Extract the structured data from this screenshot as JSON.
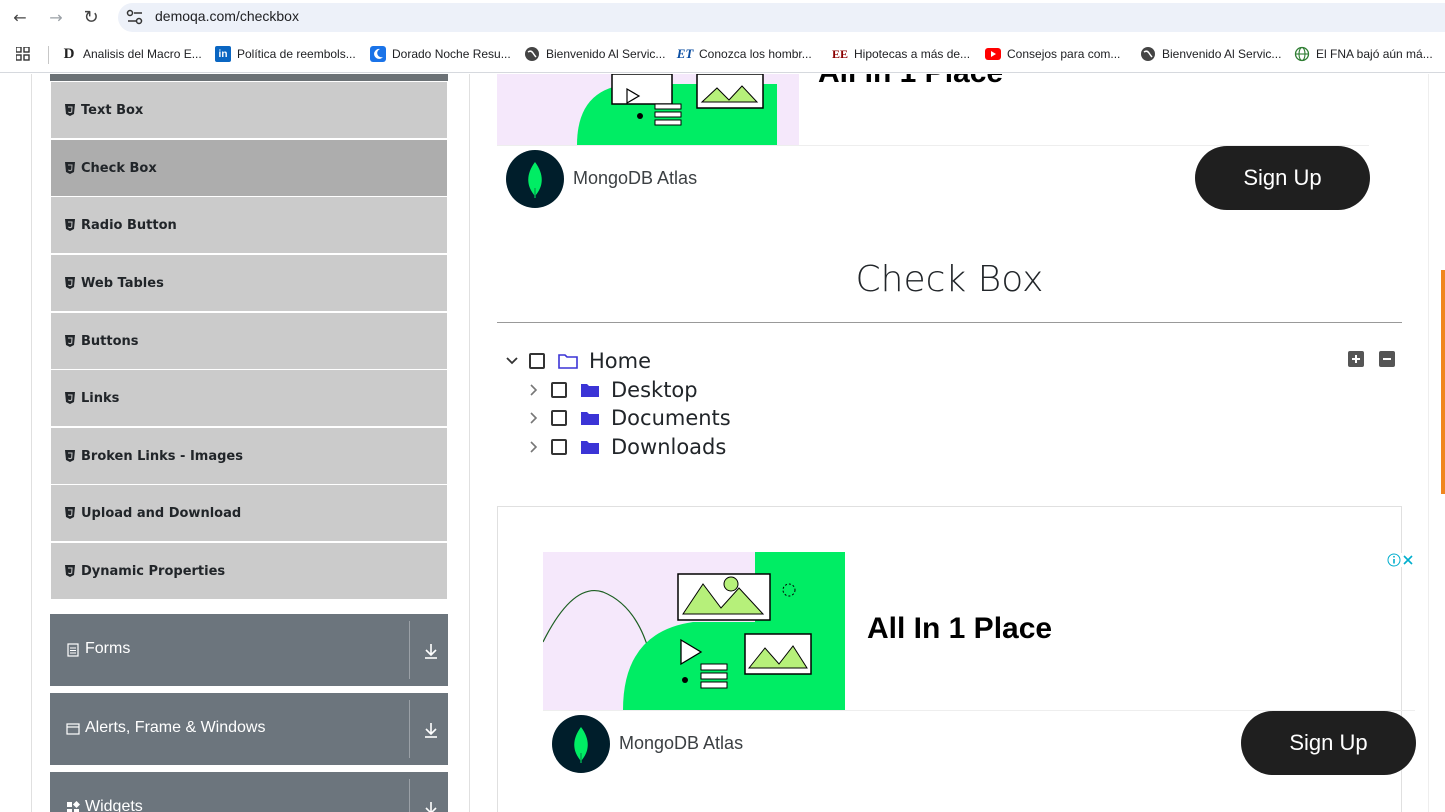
{
  "browser": {
    "url": "demoqa.com/checkbox",
    "nav": {
      "back": "←",
      "forward": "→",
      "reload": "↻"
    },
    "bookmarks": [
      {
        "label": "Analisis del Macro E...",
        "icon": "D"
      },
      {
        "label": "Política de reembols...",
        "icon": "in"
      },
      {
        "label": "Dorado Noche Resu...",
        "icon": "moon"
      },
      {
        "label": "Bienvenido Al Servic...",
        "icon": "globe"
      },
      {
        "label": "Conozca los hombr...",
        "icon": "ET"
      },
      {
        "label": "Hipotecas a más de...",
        "icon": "EE"
      },
      {
        "label": "Consejos para com...",
        "icon": "youtube"
      },
      {
        "label": "Bienvenido Al Servic...",
        "icon": "globe"
      },
      {
        "label": "El FNA bajó aún má...",
        "icon": "web"
      }
    ]
  },
  "sidebar": {
    "items": [
      {
        "label": "Text Box",
        "active": false
      },
      {
        "label": "Check Box",
        "active": true
      },
      {
        "label": "Radio Button",
        "active": false
      },
      {
        "label": "Web Tables",
        "active": false
      },
      {
        "label": "Buttons",
        "active": false
      },
      {
        "label": "Links",
        "active": false
      },
      {
        "label": "Broken Links - Images",
        "active": false
      },
      {
        "label": "Upload and Download",
        "active": false
      },
      {
        "label": "Dynamic Properties",
        "active": false
      }
    ],
    "groups": [
      {
        "label": "Forms",
        "icon": "document-icon"
      },
      {
        "label": "Alerts, Frame & Windows",
        "icon": "window-icon"
      },
      {
        "label": "Widgets",
        "icon": "widgets-icon"
      }
    ]
  },
  "top_ad": {
    "headline_partial": "All In 1 Place",
    "advertiser": "MongoDB Atlas",
    "cta": "Sign Up"
  },
  "main": {
    "title": "Check Box",
    "tree": {
      "root": {
        "label": "Home",
        "expanded": true,
        "checked": false
      },
      "children": [
        {
          "label": "Desktop",
          "expanded": false,
          "checked": false
        },
        {
          "label": "Documents",
          "expanded": false,
          "checked": false
        },
        {
          "label": "Downloads",
          "expanded": false,
          "checked": false
        }
      ],
      "expand_all": "+",
      "collapse_all": "−"
    }
  },
  "bottom_ad": {
    "headline": "All In 1 Place",
    "advertiser": "MongoDB Atlas",
    "cta": "Sign Up"
  },
  "colors": {
    "sidebar_item": "#cbcbcb",
    "sidebar_active": "#adadad",
    "group_bg": "#6c757d",
    "mongo_green": "#00ed64",
    "folder_blue": "#3b34d6",
    "cta_bg": "#1f1f1f"
  }
}
